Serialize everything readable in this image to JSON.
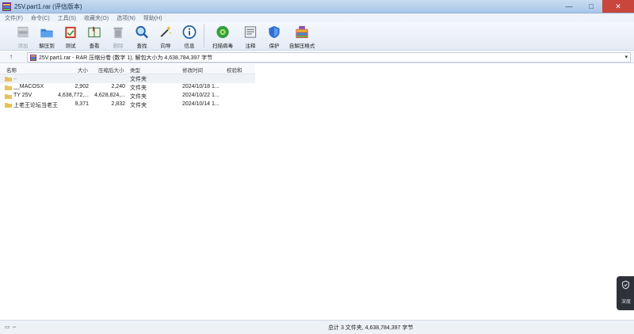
{
  "window": {
    "title": "25V.part1.rar (评估版本)",
    "minimize": "—",
    "maximize": "□",
    "close": "✕"
  },
  "menu": [
    "文件(F)",
    "命令(C)",
    "工具(S)",
    "收藏夹(O)",
    "选项(N)",
    "帮助(H)"
  ],
  "toolbar": [
    {
      "name": "add",
      "label": "添加",
      "icon": "archive-add-icon",
      "disabled": true
    },
    {
      "name": "extract-to",
      "label": "解压到",
      "icon": "folder-extract-icon",
      "disabled": false
    },
    {
      "name": "test",
      "label": "测试",
      "icon": "test-clipboard-icon",
      "disabled": false
    },
    {
      "name": "view",
      "label": "查看",
      "icon": "book-view-icon",
      "disabled": false
    },
    {
      "name": "delete",
      "label": "删除",
      "icon": "trash-icon",
      "disabled": true
    },
    {
      "name": "find",
      "label": "查找",
      "icon": "magnifier-icon",
      "disabled": false
    },
    {
      "name": "wizard",
      "label": "向导",
      "icon": "magic-wand-icon",
      "disabled": false
    },
    {
      "name": "info",
      "label": "信息",
      "icon": "info-icon",
      "disabled": false
    },
    {
      "name": "virus-scan",
      "label": "扫描病毒",
      "icon": "virus-scan-icon",
      "disabled": false
    },
    {
      "name": "comment",
      "label": "注释",
      "icon": "comment-icon",
      "disabled": false
    },
    {
      "name": "protect",
      "label": "保护",
      "icon": "shield-icon",
      "disabled": false
    },
    {
      "name": "sfx",
      "label": "自解压格式",
      "icon": "sfx-archive-icon",
      "disabled": false
    }
  ],
  "address": {
    "up": "↑",
    "path": "25V.part1.rar - RAR 压缩分卷 (数字 1), 解包大小为 4,638,784,397 字节",
    "dropdown": "▾"
  },
  "columns": [
    "名称",
    "大小",
    "压缩后大小",
    "类型",
    "修改时间",
    "校验和"
  ],
  "files": [
    {
      "name": "..",
      "size": "",
      "packed": "",
      "type": "文件夹",
      "modified": ""
    },
    {
      "name": "__MACOSX",
      "size": "2,902",
      "packed": "2,240",
      "type": "文件夹",
      "modified": "2024/10/18 1..."
    },
    {
      "name": "TY 25V",
      "size": "4,638,772,...",
      "packed": "4,628,824,...",
      "type": "文件夹",
      "modified": "2024/10/22 1..."
    },
    {
      "name": "上老王论坛当老王",
      "size": "9,371",
      "packed": "2,832",
      "type": "文件夹",
      "modified": "2024/10/14 1..."
    }
  ],
  "status": {
    "left_icons": "▭ ⇔",
    "text": "总计 3 文件夹, 4,638,784,397 字节"
  },
  "widget": {
    "label": "深度"
  },
  "colors": {
    "titlebar": "#b9d1ec",
    "close": "#c9463d",
    "folder": "#e8c15a"
  }
}
